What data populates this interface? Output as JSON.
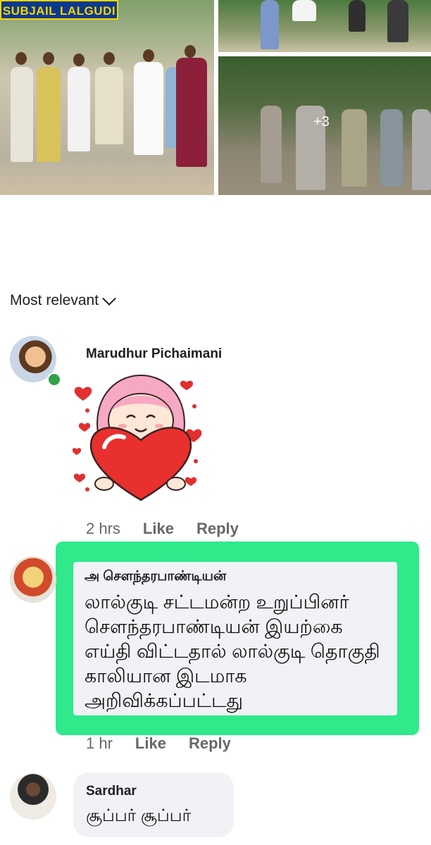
{
  "post": {
    "photos": {
      "sign_text": "SUBJAIL LALGUDI",
      "more_count": "+3"
    }
  },
  "comments_sort": {
    "label": "Most relevant"
  },
  "comments": [
    {
      "author": "Marudhur Pichaimani",
      "time": "2 hrs",
      "like_label": "Like",
      "reply_label": "Reply"
    },
    {
      "author": "அ சௌந்தரபாண்டியன்",
      "text": "லால்குடி சட்டமன்ற உறுப்பினர் சௌந்தரபாண்டியன் இயற்கை எய்தி விட்டதால் லால்குடி தொகுதி காலியான இடமாக அறிவிக்கப்பட்டது",
      "time": "1 hr",
      "like_label": "Like",
      "reply_label": "Reply"
    },
    {
      "author": "Sardhar",
      "text": "சூப்பர் சூப்பர்"
    }
  ],
  "colors": {
    "highlight": "#2fe98b",
    "online": "#31a24c",
    "bubble": "#f0f2f5"
  }
}
